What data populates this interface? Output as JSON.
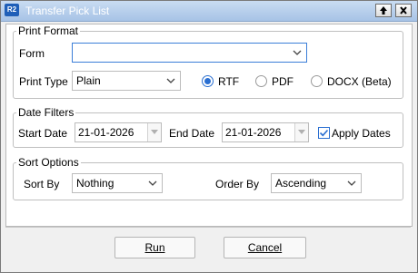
{
  "window": {
    "title": "Transfer Pick List",
    "app_badge": "R2"
  },
  "print_format": {
    "legend": "Print Format",
    "form_label": "Form",
    "form_value": "",
    "print_type_label": "Print Type",
    "print_type_value": "Plain",
    "formats": [
      {
        "label": "RTF",
        "selected": true
      },
      {
        "label": "PDF",
        "selected": false
      },
      {
        "label": "DOCX (Beta)",
        "selected": false
      }
    ]
  },
  "date_filters": {
    "legend": "Date Filters",
    "start_label": "Start Date",
    "start_value": "21-01-2026",
    "end_label": "End Date",
    "end_value": "21-01-2026",
    "apply_label": "Apply Dates",
    "apply_checked": true
  },
  "sort_options": {
    "legend": "Sort Options",
    "sort_by_label": "Sort By",
    "sort_by_value": "Nothing",
    "order_by_label": "Order By",
    "order_by_value": "Ascending"
  },
  "buttons": {
    "run": "Run",
    "cancel": "Cancel"
  },
  "icons": {
    "titlebar_up": "arrow-up-icon",
    "titlebar_close": "close-icon"
  }
}
